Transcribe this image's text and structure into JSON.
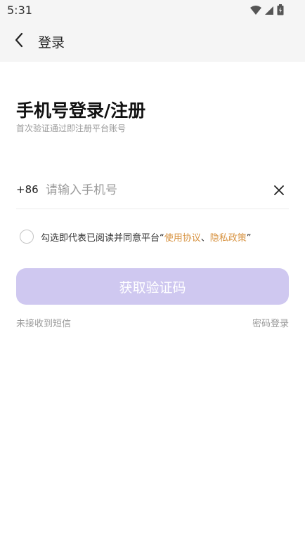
{
  "status_bar": {
    "time": "5:31",
    "icons": [
      "wifi-icon",
      "signal-icon",
      "battery-icon"
    ]
  },
  "header": {
    "back_icon": "chevron-left-icon",
    "title": "登录"
  },
  "main": {
    "heading": "手机号登录/注册",
    "subheading": "首次验证通过即注册平台账号",
    "phone": {
      "country_code": "+86",
      "placeholder": "请输入手机号",
      "value": ""
    },
    "clear_icon": "close-icon",
    "agreement": {
      "checked": false,
      "prefix": "勾选即代表已阅读并同意平台“",
      "link1": "使用协议",
      "separator": "、",
      "link2": "隐私政策",
      "suffix": "”"
    },
    "submit_label": "获取验证码",
    "help_link": "未接收到短信",
    "alt_login_link": "密码登录"
  },
  "colors": {
    "accent_button": "#cfc8f0",
    "link": "#d89443",
    "muted_text": "#9a9a9a"
  }
}
